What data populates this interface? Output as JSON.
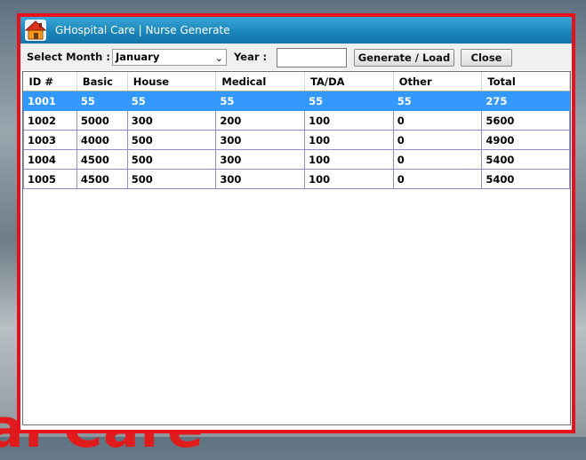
{
  "background": {
    "brand_text": "al Care"
  },
  "window": {
    "title": "GHospital Care  |  Nurse Generate",
    "icon": "home-icon",
    "accent_color": "#e8101a",
    "titlebar_color": "#1b86bd"
  },
  "toolbar": {
    "month_label": "Select Month  :",
    "month_value": "January",
    "year_label": "Year  :",
    "year_value": "",
    "generate_label": "Generate / Load",
    "close_label": "Close"
  },
  "table": {
    "columns": [
      "ID #",
      "Basic",
      "House",
      "Medical",
      "TA/DA",
      "Other",
      "Total"
    ],
    "rows": [
      [
        "1001",
        "55",
        "55",
        "55",
        "55",
        "55",
        "275"
      ],
      [
        "1002",
        "5000",
        "300",
        "200",
        "100",
        "0",
        "5600"
      ],
      [
        "1003",
        "4000",
        "500",
        "300",
        "100",
        "0",
        "4900"
      ],
      [
        "1004",
        "4500",
        "500",
        "300",
        "100",
        "0",
        "5400"
      ],
      [
        "1005",
        "4500",
        "500",
        "300",
        "100",
        "0",
        "5400"
      ]
    ],
    "selected_row": 0,
    "selection_color": "#3399ff"
  }
}
